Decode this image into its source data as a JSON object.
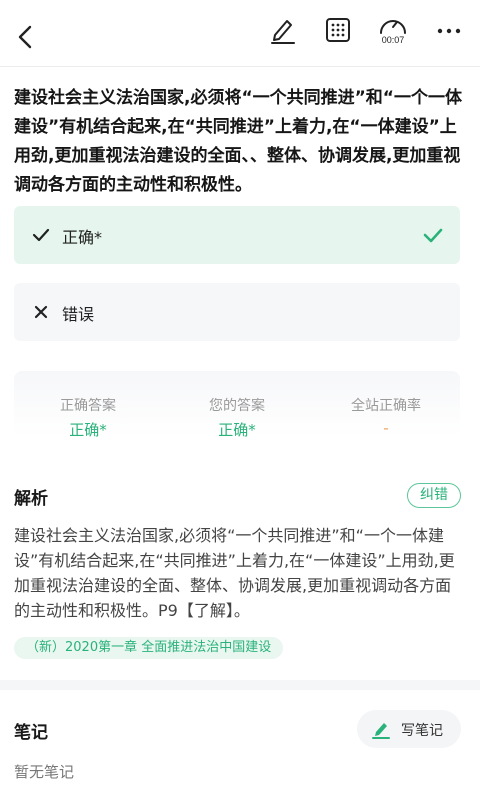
{
  "topbar": {
    "timer_text": "00:07",
    "icons": [
      "back-arrow-icon",
      "edit-icon",
      "answer-sheet-grid-icon",
      "timer-icon",
      "more-icon"
    ]
  },
  "question": {
    "text": "建设社会主义法治国家,必须将“一个共同推进”和“一个一体建设”有机结合起来,在“共同推进”上着力,在“一体建设”上用劲,更加重视法治建设的全面、、整体、协调发展,更加重视调动各方面的主动性和积极性。"
  },
  "options": [
    {
      "label": "正确*",
      "state": "selected-correct",
      "mark_icon": "check-icon"
    },
    {
      "label": "错误",
      "state": "normal",
      "mark_icon": "cross-icon"
    }
  ],
  "stats": {
    "correct_answer_label": "正确答案",
    "correct_answer_value": "正确*",
    "your_answer_label": "您的答案",
    "your_answer_value": "正确*",
    "site_rate_label": "全站正确率",
    "site_rate_value": "-"
  },
  "analysis": {
    "title": "解析",
    "report_button": "纠错",
    "text": "建设社会主义法治国家,必须将“一个共同推进”和“一个一体建设”有机结合起来,在“共同推进”上着力,在“一体建设”上用劲,更加重视法治建设的全面、整体、协调发展,更加重视调动各方面的主动性和积极性。P9【了解】。",
    "tag": "（新）2020第一章 全面推进法治中国建设"
  },
  "notes": {
    "title": "笔记",
    "write_button": "写笔记",
    "empty_text": "暂无笔记"
  },
  "colors": {
    "accent_green": "#2ab27b",
    "correct_option_bg": "#e6f6ee",
    "neutral_bg": "#f6f7f9",
    "dash_orange": "#f0a35a"
  }
}
